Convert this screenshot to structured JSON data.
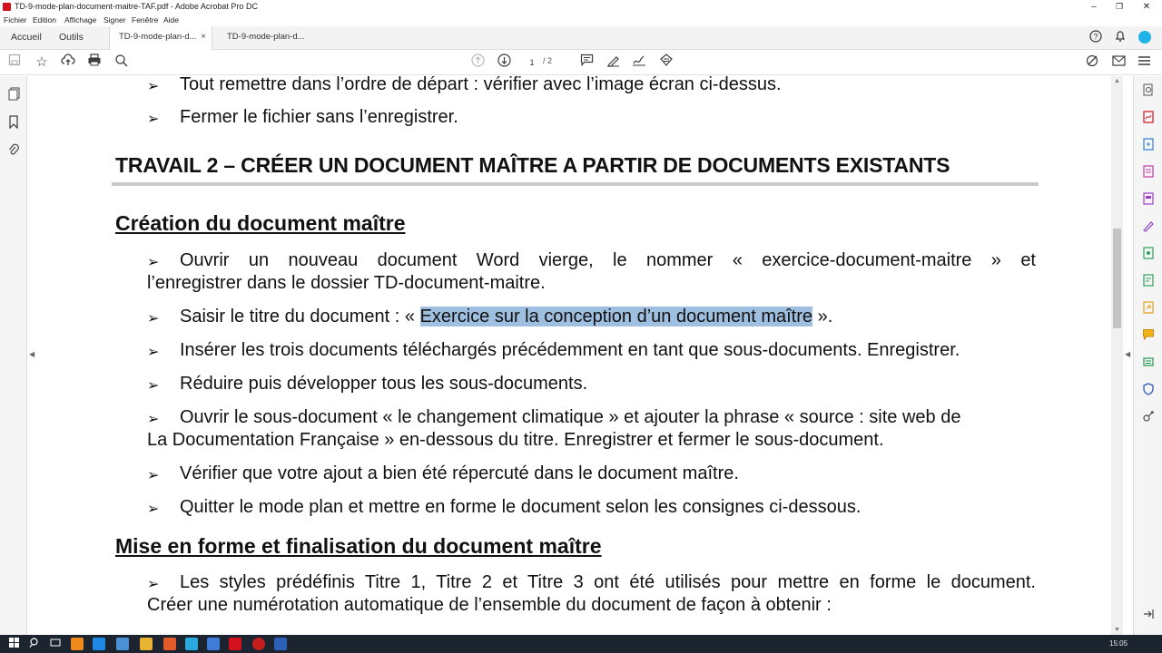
{
  "window": {
    "title": "TD-9-mode-plan-document-maitre-TAF.pdf - Adobe Acrobat Pro DC",
    "minimize": "–",
    "maximize": "❐",
    "close": "✕"
  },
  "menu": [
    "Fichier",
    "Edition",
    "Affichage",
    "Signer",
    "Fenêtre",
    "Aide"
  ],
  "tabs": {
    "home": "Accueil",
    "tools": "Outils",
    "doc1": "TD-9-mode-plan-d...",
    "doc2": "TD-9-mode-plan-d...",
    "close": "×"
  },
  "toolbar": {
    "current_page": "1",
    "page_sep": "/ 2"
  },
  "document": {
    "lines": {
      "l1": "Tout remettre dans l’ordre de départ : vérifier avec l’image écran ci-dessus.",
      "l2": "Fermer le fichier sans l’enregistrer.",
      "h1": "TRAVAIL 2 – CRÉER UN DOCUMENT MAÎTRE A PARTIR DE DOCUMENTS EXISTANTS",
      "h2a": "Création du document maître",
      "b1a": "Ouvrir un nouveau document Word vierge, le nommer « exercice-document-maitre » et",
      "b1b": "l’enregistrer dans le dossier TD-document-maitre.",
      "b2_pre": "Saisir le titre du document : «",
      "b2_hl": "Exercice sur la conception d’un document maître",
      "b2_post": "».",
      "b3": "Insérer les trois documents téléchargés précédemment en tant que sous-documents. Enregistrer.",
      "b4": "Réduire puis développer tous les sous-documents.",
      "b5a": "Ouvrir le sous-document « le changement climatique » et ajouter la phrase « source : site web de",
      "b5b": "La Documentation Française » en-dessous du titre. Enregistrer et fermer le sous-document.",
      "b6": "Vérifier que votre ajout a bien été répercuté dans le document maître.",
      "b7": "Quitter le mode plan et mettre en forme le document selon les consignes ci-dessous.",
      "h2b": "Mise en forme et finalisation du document maître",
      "b8a": "Les styles prédéfinis Titre 1, Titre 2 et Titre 3 ont été utilisés pour mettre en forme le document.",
      "b8b": "Créer une numérotation automatique de l’ensemble du document de façon à obtenir :"
    },
    "bullet_glyph": "➢"
  },
  "taskbar": {
    "clock": "15:05"
  },
  "colors": {
    "highlight": "#9fbfe0",
    "acrobat_red": "#d4111e",
    "taskbar": "#1c2430"
  }
}
